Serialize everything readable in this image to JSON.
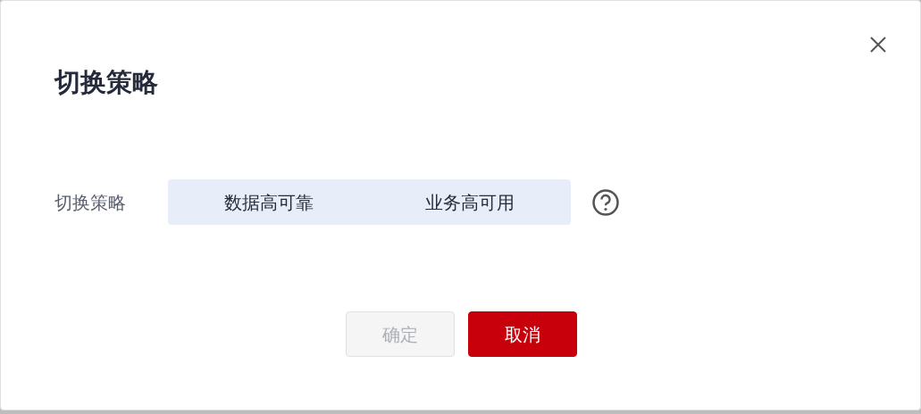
{
  "dialog": {
    "title": "切换策略"
  },
  "field": {
    "label": "切换策略",
    "options": [
      {
        "label": "数据高可靠",
        "selected": false
      },
      {
        "label": "业务高可用",
        "selected": false
      }
    ]
  },
  "buttons": [
    {
      "label": "确定",
      "disabled": true,
      "kind": "secondary"
    },
    {
      "label": "取消",
      "disabled": false,
      "kind": "primary"
    }
  ]
}
